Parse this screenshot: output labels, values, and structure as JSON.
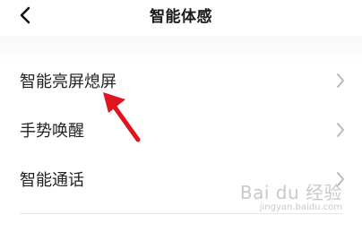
{
  "header": {
    "back_icon": "chevron-left-icon",
    "title": "智能体感"
  },
  "settings": {
    "items": [
      {
        "label": "智能亮屏熄屏",
        "icon": "chevron-right-icon"
      },
      {
        "label": "手势唤醒",
        "icon": "chevron-right-icon"
      },
      {
        "label": "智能通话",
        "icon": "chevron-right-icon"
      }
    ]
  },
  "annotation": {
    "arrow_color": "#e0141e",
    "arrow_icon": "red-arrow-icon"
  },
  "watermark": {
    "logo": "Bai du 经验",
    "url": "jingyan.baidu.com"
  }
}
